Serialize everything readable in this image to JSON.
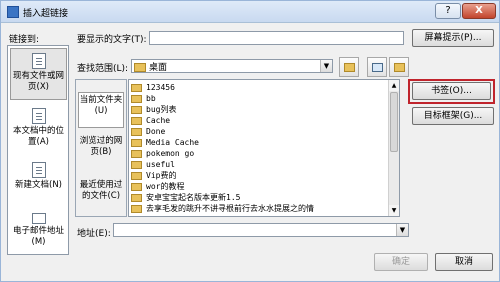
{
  "window": {
    "title": "插入超链接",
    "help": "?",
    "close": "X"
  },
  "link_to": {
    "label": "链接到:",
    "items": [
      {
        "label": "现有文件或网页(X)"
      },
      {
        "label": "本文档中的位置(A)"
      },
      {
        "label": "新建文档(N)"
      },
      {
        "label": "电子邮件地址(M)"
      }
    ]
  },
  "display_text": {
    "label": "要显示的文字(T):",
    "value": ""
  },
  "screentip_button": "屏幕提示(P)...",
  "look_in": {
    "label": "查找范围(L):",
    "value": "桌面"
  },
  "scopes": [
    {
      "label": "当前文件夹(U)"
    },
    {
      "label": "浏览过的网页(B)"
    },
    {
      "label": "最近使用过的文件(C)"
    }
  ],
  "files": [
    "123456",
    "bb",
    "bug列表",
    "Cache",
    "Done",
    "Media Cache",
    "pokemon go",
    "useful",
    "Vip费的",
    "wor的教程",
    "安卓宝宝起名版本更新1.5",
    "去享毛发的跳升不讲寻根前行去水水提展之的情"
  ],
  "bookmark_button": "书签(O)...",
  "target_frame_button": "目标框架(G)...",
  "address": {
    "label": "地址(E):",
    "value": ""
  },
  "ok_button": "确定",
  "cancel_button": "取消"
}
